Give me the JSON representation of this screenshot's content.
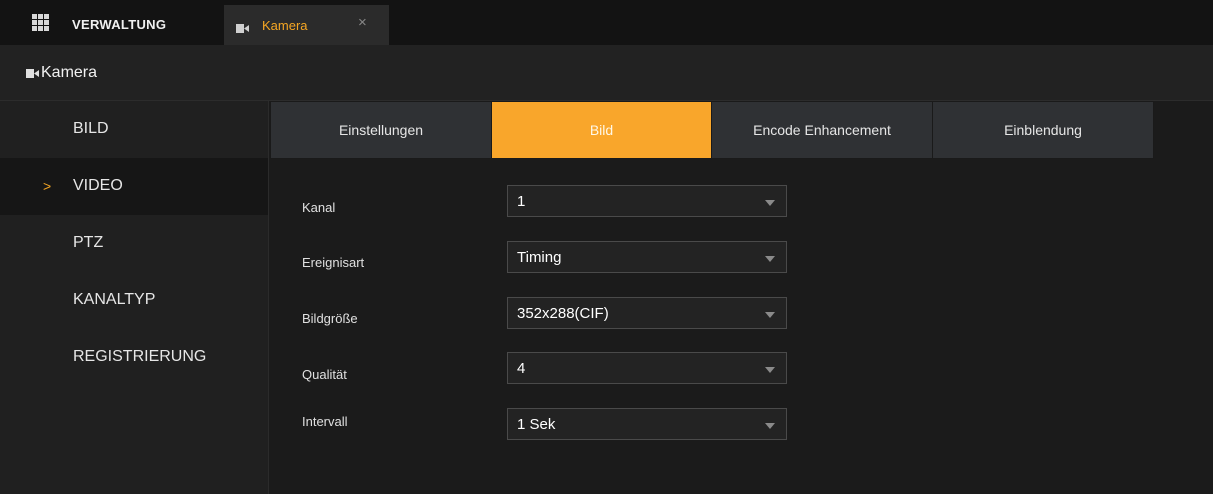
{
  "topbar": {
    "brand": "VERWALTUNG",
    "tab": {
      "label": "Kamera",
      "close": "×"
    }
  },
  "header": {
    "title": "Kamera"
  },
  "sidebar": {
    "items": [
      {
        "label": "BILD",
        "active": false
      },
      {
        "label": "VIDEO",
        "active": true,
        "marker": ">"
      },
      {
        "label": "PTZ",
        "active": false
      },
      {
        "label": "KANALTYP",
        "active": false
      },
      {
        "label": "REGISTRIERUNG",
        "active": false
      }
    ]
  },
  "tabs": [
    {
      "label": "Einstellungen",
      "active": false
    },
    {
      "label": "Bild",
      "active": true
    },
    {
      "label": "Encode Enhancement",
      "active": false
    },
    {
      "label": "Einblendung",
      "active": false
    }
  ],
  "form": {
    "fields": [
      {
        "label": "Kanal",
        "value": "1"
      },
      {
        "label": "Ereignisart",
        "value": "Timing"
      },
      {
        "label": "Bildgröße",
        "value": "352x288(CIF)"
      },
      {
        "label": "Qualität",
        "value": "4"
      },
      {
        "label": "Intervall",
        "value": "1 Sek"
      }
    ]
  },
  "colors": {
    "accent": "#f9a62b",
    "background": "#1b1b1b",
    "panel": "#2f3134"
  },
  "icons": [
    "grid-menu-icon",
    "camera-icon",
    "close-icon",
    "chevron-right-icon",
    "dropdown-arrow-icon"
  ]
}
